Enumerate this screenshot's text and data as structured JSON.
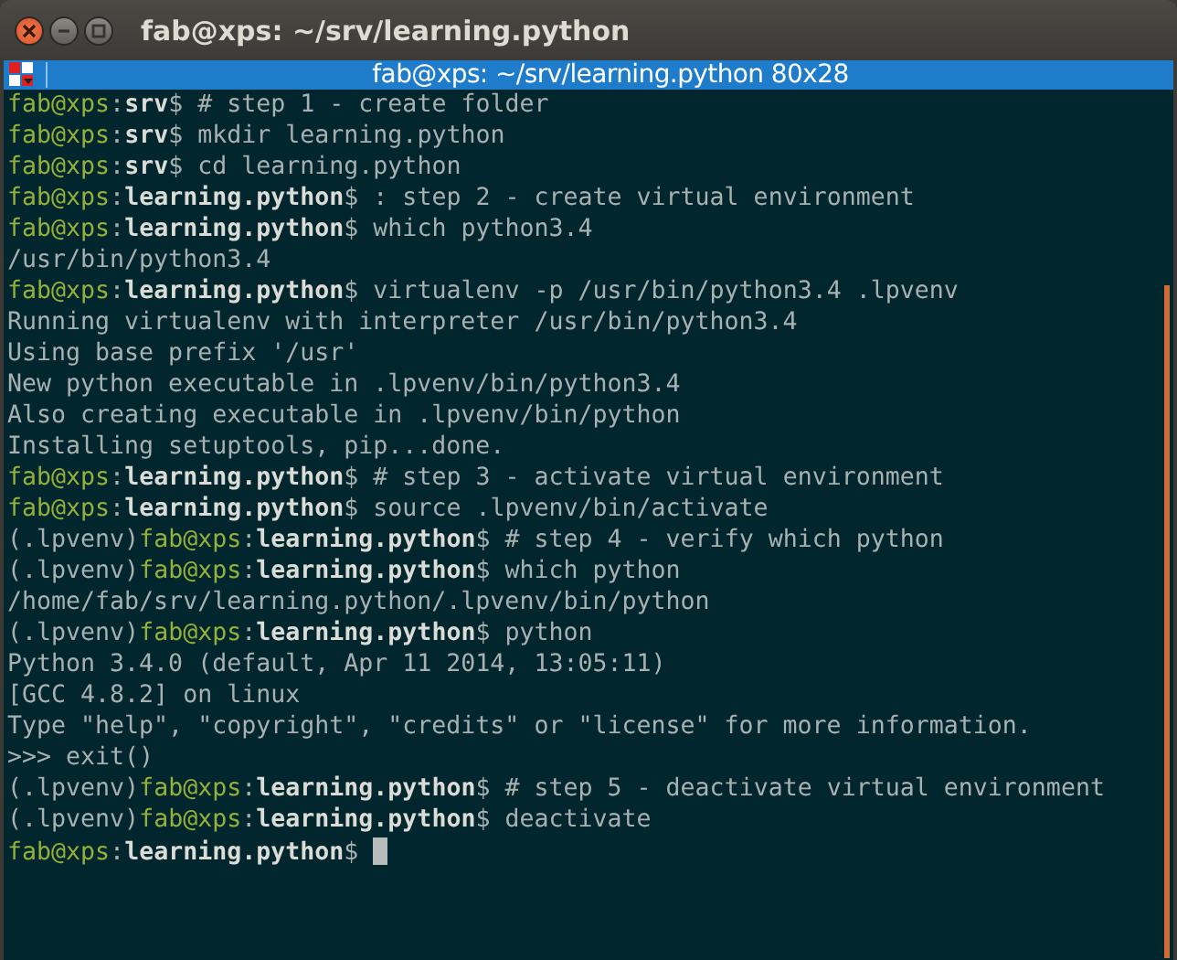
{
  "window": {
    "title": "fab@xps: ~/srv/learning.python"
  },
  "terminal": {
    "title": "fab@xps: ~/srv/learning.python 80x28",
    "lines": [
      {
        "kind": "prompt",
        "user": "fab@xps",
        "sep": ":",
        "path": "srv",
        "dollar": "$",
        "command": "# step 1 - create folder"
      },
      {
        "kind": "prompt",
        "user": "fab@xps",
        "sep": ":",
        "path": "srv",
        "dollar": "$",
        "command": "mkdir learning.python"
      },
      {
        "kind": "prompt",
        "user": "fab@xps",
        "sep": ":",
        "path": "srv",
        "dollar": "$",
        "command": "cd learning.python"
      },
      {
        "kind": "prompt",
        "user": "fab@xps",
        "sep": ":",
        "path": "learning.python",
        "dollar": "$",
        "command": ": step 2 - create virtual environment"
      },
      {
        "kind": "prompt",
        "user": "fab@xps",
        "sep": ":",
        "path": "learning.python",
        "dollar": "$",
        "command": "which python3.4"
      },
      {
        "kind": "output",
        "text": "/usr/bin/python3.4"
      },
      {
        "kind": "prompt",
        "user": "fab@xps",
        "sep": ":",
        "path": "learning.python",
        "dollar": "$",
        "command": "virtualenv -p /usr/bin/python3.4 .lpvenv"
      },
      {
        "kind": "output",
        "text": "Running virtualenv with interpreter /usr/bin/python3.4"
      },
      {
        "kind": "output",
        "text": "Using base prefix '/usr'"
      },
      {
        "kind": "output",
        "text": "New python executable in .lpvenv/bin/python3.4"
      },
      {
        "kind": "output",
        "text": "Also creating executable in .lpvenv/bin/python"
      },
      {
        "kind": "output",
        "text": "Installing setuptools, pip...done."
      },
      {
        "kind": "prompt",
        "user": "fab@xps",
        "sep": ":",
        "path": "learning.python",
        "dollar": "$",
        "command": "# step 3 - activate virtual environment"
      },
      {
        "kind": "prompt",
        "user": "fab@xps",
        "sep": ":",
        "path": "learning.python",
        "dollar": "$",
        "command": "source .lpvenv/bin/activate"
      },
      {
        "kind": "prompt",
        "venv": "(.lpvenv)",
        "user": "fab@xps",
        "sep": ":",
        "path": "learning.python",
        "dollar": "$",
        "command": "# step 4 - verify which python"
      },
      {
        "kind": "prompt",
        "venv": "(.lpvenv)",
        "user": "fab@xps",
        "sep": ":",
        "path": "learning.python",
        "dollar": "$",
        "command": "which python"
      },
      {
        "kind": "output",
        "text": "/home/fab/srv/learning.python/.lpvenv/bin/python"
      },
      {
        "kind": "prompt",
        "venv": "(.lpvenv)",
        "user": "fab@xps",
        "sep": ":",
        "path": "learning.python",
        "dollar": "$",
        "command": "python"
      },
      {
        "kind": "output",
        "text": "Python 3.4.0 (default, Apr 11 2014, 13:05:11)"
      },
      {
        "kind": "output",
        "text": "[GCC 4.8.2] on linux"
      },
      {
        "kind": "output",
        "text": "Type \"help\", \"copyright\", \"credits\" or \"license\" for more information."
      },
      {
        "kind": "output",
        "text": ">>> exit()"
      },
      {
        "kind": "prompt",
        "venv": "(.lpvenv)",
        "user": "fab@xps",
        "sep": ":",
        "path": "learning.python",
        "dollar": "$",
        "command": "# step 5 - deactivate virtual environment"
      },
      {
        "kind": "prompt",
        "venv": "(.lpvenv)",
        "user": "fab@xps",
        "sep": ":",
        "path": "learning.python",
        "dollar": "$",
        "command": "deactivate"
      },
      {
        "kind": "prompt",
        "user": "fab@xps",
        "sep": ":",
        "path": "learning.python",
        "dollar": "$",
        "cursor": true
      }
    ]
  }
}
